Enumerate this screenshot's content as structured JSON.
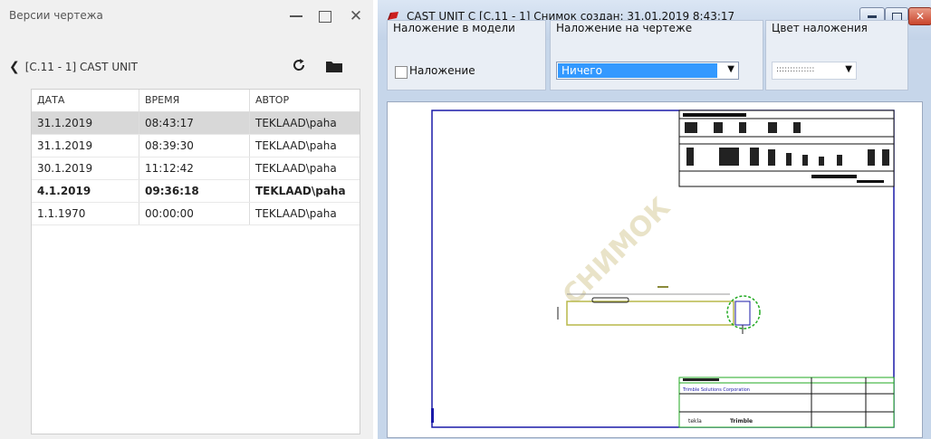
{
  "left_panel": {
    "title": "Версии чертежа",
    "breadcrumb": "[C.11 - 1] CAST UNIT",
    "columns": [
      "ДАТА",
      "ВРЕМЯ",
      "АВТОР"
    ],
    "rows": [
      {
        "date": "31.1.2019",
        "time": "08:43:17",
        "author": "TEKLAAD\\paha"
      },
      {
        "date": "31.1.2019",
        "time": "08:39:30",
        "author": "TEKLAAD\\paha"
      },
      {
        "date": "30.1.2019",
        "time": "11:12:42",
        "author": "TEKLAAD\\paha"
      },
      {
        "date": "4.1.2019",
        "time": "09:36:18",
        "author": "TEKLAAD\\paha"
      },
      {
        "date": "1.1.1970",
        "time": "00:00:00",
        "author": "TEKLAAD\\paha"
      }
    ]
  },
  "right_panel": {
    "title": "CAST UNIT C  [C.11 - 1]  Снимок создан: 31.01.2019 8:43:17",
    "group_model_overlay": {
      "label": "Наложение в модели",
      "checkbox_label": "Наложение"
    },
    "group_drawing_overlay": {
      "label": "Наложение на чертеже",
      "selected": "Ничего"
    },
    "group_overlay_color": {
      "label": "Цвет наложения"
    },
    "watermark": "СНИМОК",
    "drawing_texts": {
      "company": "Trimble Solutions Corporation",
      "tekla": "tekla",
      "trimble": "Trimble"
    }
  },
  "colors": {
    "window_bg": "#c6d6ea",
    "selection": "#3399ff",
    "drawing_frame": "#1a1aa8",
    "overlay_green": "#22aa22"
  }
}
